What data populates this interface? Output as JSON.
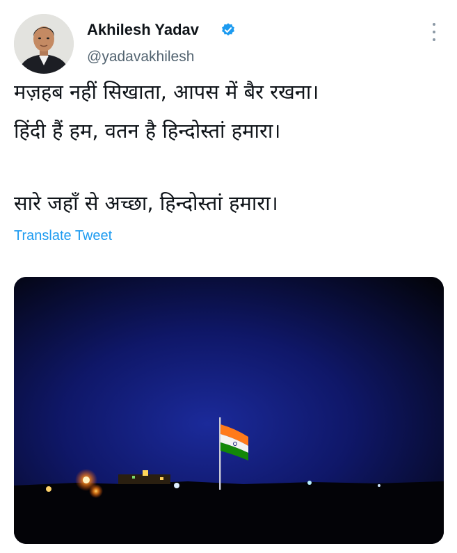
{
  "author": {
    "display_name": "Akhilesh Yadav",
    "handle": "@yadavakhilesh",
    "verified": true,
    "verified_icon": "verified-badge-icon",
    "verified_color": "#1d9bf0"
  },
  "tweet": {
    "lines": [
      "मज़हब नहीं सिखाता, आपस में बैर रखना।",
      "हिंदी हैं हम, वतन है हिन्दोस्तां हमारा।",
      "सारे जहाँ से अच्छा, हिन्दोस्तां हमारा।"
    ],
    "translate_label": "Translate Tweet"
  },
  "more_menu_icon": "more-vertical-icon",
  "media": {
    "description_icon": "night-flag-photo",
    "accent_colors": [
      "#0c1360",
      "#ff8a1a",
      "#138808"
    ]
  },
  "colors": {
    "text": "#0f1419",
    "secondary": "#536471",
    "link": "#1d9bf0"
  }
}
